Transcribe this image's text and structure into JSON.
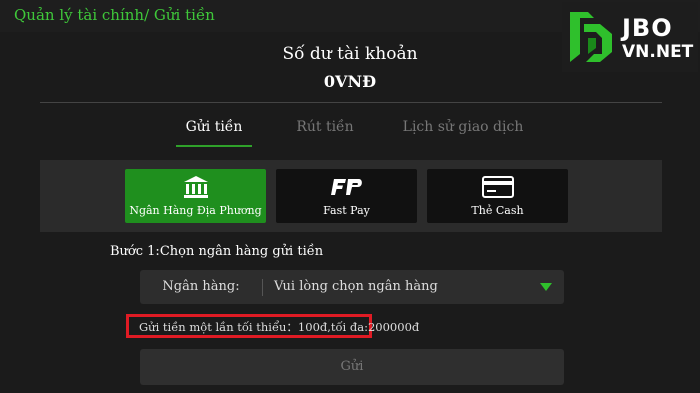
{
  "breadcrumb": "Quản lý tài chính/ Gửi tiền",
  "logo": {
    "line1": "JBO",
    "line2": "VN.NET"
  },
  "balance": {
    "label": "Số dư tài khoản",
    "value": "0VNĐ"
  },
  "tabs": [
    {
      "label": "Gửi tiền",
      "active": true
    },
    {
      "label": "Rút tiền",
      "active": false
    },
    {
      "label": "Lịch sử giao dịch",
      "active": false
    }
  ],
  "methods": [
    {
      "label": "Ngân Hàng Địa Phương",
      "icon": "bank-icon",
      "active": true
    },
    {
      "label": "Fast Pay",
      "icon": "fastpay-icon",
      "active": false
    },
    {
      "label": "Thẻ Cash",
      "icon": "card-icon",
      "active": false
    }
  ],
  "step_text": "Bước 1:Chọn ngân hàng gửi tiền",
  "bank_select": {
    "label": "Ngân hàng:",
    "value": "Vui lòng chọn ngân hàng"
  },
  "limit_text": "Gửi tiền một lần tối thiểu：100đ,tối đa:200000đ",
  "submit_label": "Gửi",
  "colors": {
    "accent": "#2fa12a",
    "highlight_box": "#e01b24",
    "breadcrumb": "#3fc83a"
  }
}
